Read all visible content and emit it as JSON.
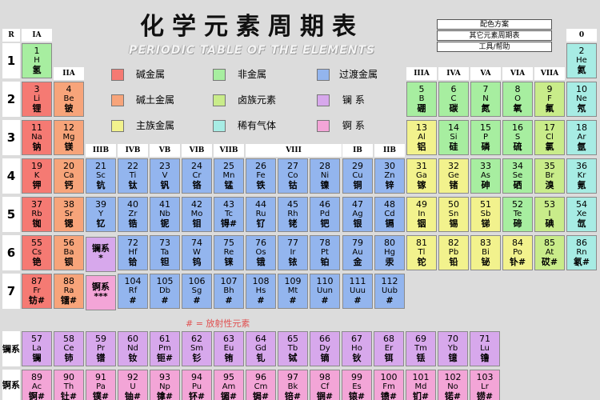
{
  "title": "化学元素周期表",
  "subtitle": "PERIODIC TABLE OF THE ELEMENTS",
  "menu": [
    "配色方案",
    "其它元素周期表",
    "工具/帮助"
  ],
  "r_label": "R",
  "group_headers": {
    "ia": "IA",
    "iia": "IIA",
    "iiia": "IIIA",
    "iva": "IVA",
    "va": "VA",
    "via": "VIA",
    "viia": "VIIA",
    "zero": "0",
    "iiib": "IIIB",
    "ivb": "IVB",
    "vb": "VB",
    "vib": "VIB",
    "viib": "VIIB",
    "viii": "VIII",
    "ib": "IB",
    "iib": "IIB"
  },
  "periods": [
    "1",
    "2",
    "3",
    "4",
    "5",
    "6",
    "7"
  ],
  "legend": [
    {
      "label": "碱金属",
      "color": "#f57a73"
    },
    {
      "label": "非金属",
      "color": "#a7eea0"
    },
    {
      "label": "过渡金属",
      "color": "#93b5ee"
    },
    {
      "label": "碱土金属",
      "color": "#f7a47a"
    },
    {
      "label": "卤族元素",
      "color": "#c9ec8a"
    },
    {
      "label": "镧 系",
      "color": "#d7a8ec"
    },
    {
      "label": "主族金属",
      "color": "#f2f28d"
    },
    {
      "label": "稀有气体",
      "color": "#a7ece4"
    },
    {
      "label": "锕 系",
      "color": "#f3a5d7"
    }
  ],
  "radio_note": "# = 放射性元素",
  "series_labels": {
    "la": "镧系",
    "ac": "锕系"
  },
  "la_placeholder": {
    "text1": "镧系",
    "text2": "*"
  },
  "ac_placeholder": {
    "text1": "锕系",
    "text2": "***"
  },
  "elements": [
    {
      "n": "1",
      "s": "H",
      "c": "氢",
      "cat": "nm",
      "r": 0,
      "g": 1
    },
    {
      "n": "2",
      "s": "He",
      "c": "氦",
      "cat": "ng",
      "r": 0,
      "g": 18
    },
    {
      "n": "3",
      "s": "Li",
      "c": "锂",
      "cat": "alk",
      "r": 1,
      "g": 1
    },
    {
      "n": "4",
      "s": "Be",
      "c": "铍",
      "cat": "ae",
      "r": 1,
      "g": 2
    },
    {
      "n": "5",
      "s": "B",
      "c": "硼",
      "cat": "nm",
      "r": 1,
      "g": 13
    },
    {
      "n": "6",
      "s": "C",
      "c": "碳",
      "cat": "nm",
      "r": 1,
      "g": 14
    },
    {
      "n": "7",
      "s": "N",
      "c": "氮",
      "cat": "nm",
      "r": 1,
      "g": 15
    },
    {
      "n": "8",
      "s": "O",
      "c": "氧",
      "cat": "nm",
      "r": 1,
      "g": 16
    },
    {
      "n": "9",
      "s": "F",
      "c": "氟",
      "cat": "hal",
      "r": 1,
      "g": 17
    },
    {
      "n": "10",
      "s": "Ne",
      "c": "氖",
      "cat": "ng",
      "r": 1,
      "g": 18
    },
    {
      "n": "11",
      "s": "Na",
      "c": "钠",
      "cat": "alk",
      "r": 2,
      "g": 1
    },
    {
      "n": "12",
      "s": "Mg",
      "c": "镁",
      "cat": "ae",
      "r": 2,
      "g": 2
    },
    {
      "n": "13",
      "s": "Al",
      "c": "铝",
      "cat": "pm",
      "r": 2,
      "g": 13
    },
    {
      "n": "14",
      "s": "Si",
      "c": "硅",
      "cat": "nm",
      "r": 2,
      "g": 14
    },
    {
      "n": "15",
      "s": "P",
      "c": "磷",
      "cat": "nm",
      "r": 2,
      "g": 15
    },
    {
      "n": "16",
      "s": "S",
      "c": "硫",
      "cat": "nm",
      "r": 2,
      "g": 16
    },
    {
      "n": "17",
      "s": "Cl",
      "c": "氯",
      "cat": "hal",
      "r": 2,
      "g": 17
    },
    {
      "n": "18",
      "s": "Ar",
      "c": "氩",
      "cat": "ng",
      "r": 2,
      "g": 18
    },
    {
      "n": "19",
      "s": "K",
      "c": "钾",
      "cat": "alk",
      "r": 3,
      "g": 1
    },
    {
      "n": "20",
      "s": "Ca",
      "c": "钙",
      "cat": "ae",
      "r": 3,
      "g": 2
    },
    {
      "n": "21",
      "s": "Sc",
      "c": "钪",
      "cat": "tm",
      "r": 3,
      "g": 3
    },
    {
      "n": "22",
      "s": "Ti",
      "c": "钛",
      "cat": "tm",
      "r": 3,
      "g": 4
    },
    {
      "n": "23",
      "s": "V",
      "c": "钒",
      "cat": "tm",
      "r": 3,
      "g": 5
    },
    {
      "n": "24",
      "s": "Cr",
      "c": "铬",
      "cat": "tm",
      "r": 3,
      "g": 6
    },
    {
      "n": "25",
      "s": "Mn",
      "c": "锰",
      "cat": "tm",
      "r": 3,
      "g": 7
    },
    {
      "n": "26",
      "s": "Fe",
      "c": "铁",
      "cat": "tm",
      "r": 3,
      "g": 8
    },
    {
      "n": "27",
      "s": "Co",
      "c": "钴",
      "cat": "tm",
      "r": 3,
      "g": 9
    },
    {
      "n": "28",
      "s": "Ni",
      "c": "镍",
      "cat": "tm",
      "r": 3,
      "g": 10
    },
    {
      "n": "29",
      "s": "Cu",
      "c": "铜",
      "cat": "tm",
      "r": 3,
      "g": 11
    },
    {
      "n": "30",
      "s": "Zn",
      "c": "锌",
      "cat": "tm",
      "r": 3,
      "g": 12
    },
    {
      "n": "31",
      "s": "Ga",
      "c": "镓",
      "cat": "pm",
      "r": 3,
      "g": 13
    },
    {
      "n": "32",
      "s": "Ge",
      "c": "锗",
      "cat": "pm",
      "r": 3,
      "g": 14
    },
    {
      "n": "33",
      "s": "As",
      "c": "砷",
      "cat": "nm",
      "r": 3,
      "g": 15
    },
    {
      "n": "34",
      "s": "Se",
      "c": "硒",
      "cat": "nm",
      "r": 3,
      "g": 16
    },
    {
      "n": "35",
      "s": "Br",
      "c": "溴",
      "cat": "hal",
      "r": 3,
      "g": 17
    },
    {
      "n": "36",
      "s": "Kr",
      "c": "氪",
      "cat": "ng",
      "r": 3,
      "g": 18
    },
    {
      "n": "37",
      "s": "Rb",
      "c": "铷",
      "cat": "alk",
      "r": 4,
      "g": 1
    },
    {
      "n": "38",
      "s": "Sr",
      "c": "锶",
      "cat": "ae",
      "r": 4,
      "g": 2
    },
    {
      "n": "39",
      "s": "Y",
      "c": "钇",
      "cat": "tm",
      "r": 4,
      "g": 3
    },
    {
      "n": "40",
      "s": "Zr",
      "c": "锆",
      "cat": "tm",
      "r": 4,
      "g": 4
    },
    {
      "n": "41",
      "s": "Nb",
      "c": "铌",
      "cat": "tm",
      "r": 4,
      "g": 5
    },
    {
      "n": "42",
      "s": "Mo",
      "c": "钼",
      "cat": "tm",
      "r": 4,
      "g": 6
    },
    {
      "n": "43",
      "s": "Tc",
      "c": "锝#",
      "cat": "tm",
      "r": 4,
      "g": 7
    },
    {
      "n": "44",
      "s": "Ru",
      "c": "钌",
      "cat": "tm",
      "r": 4,
      "g": 8
    },
    {
      "n": "45",
      "s": "Rh",
      "c": "铑",
      "cat": "tm",
      "r": 4,
      "g": 9
    },
    {
      "n": "46",
      "s": "Pd",
      "c": "钯",
      "cat": "tm",
      "r": 4,
      "g": 10
    },
    {
      "n": "47",
      "s": "Ag",
      "c": "银",
      "cat": "tm",
      "r": 4,
      "g": 11
    },
    {
      "n": "48",
      "s": "Cd",
      "c": "镉",
      "cat": "tm",
      "r": 4,
      "g": 12
    },
    {
      "n": "49",
      "s": "In",
      "c": "铟",
      "cat": "pm",
      "r": 4,
      "g": 13
    },
    {
      "n": "50",
      "s": "Sn",
      "c": "锡",
      "cat": "pm",
      "r": 4,
      "g": 14
    },
    {
      "n": "51",
      "s": "Sb",
      "c": "锑",
      "cat": "pm",
      "r": 4,
      "g": 15
    },
    {
      "n": "52",
      "s": "Te",
      "c": "碲",
      "cat": "nm",
      "r": 4,
      "g": 16
    },
    {
      "n": "53",
      "s": "I",
      "c": "碘",
      "cat": "hal",
      "r": 4,
      "g": 17
    },
    {
      "n": "54",
      "s": "Xe",
      "c": "氙",
      "cat": "ng",
      "r": 4,
      "g": 18
    },
    {
      "n": "55",
      "s": "Cs",
      "c": "铯",
      "cat": "alk",
      "r": 5,
      "g": 1
    },
    {
      "n": "56",
      "s": "Ba",
      "c": "钡",
      "cat": "ae",
      "r": 5,
      "g": 2
    },
    {
      "n": "72",
      "s": "Hf",
      "c": "铪",
      "cat": "tm",
      "r": 5,
      "g": 4
    },
    {
      "n": "73",
      "s": "Ta",
      "c": "钽",
      "cat": "tm",
      "r": 5,
      "g": 5
    },
    {
      "n": "74",
      "s": "W",
      "c": "钨",
      "cat": "tm",
      "r": 5,
      "g": 6
    },
    {
      "n": "75",
      "s": "Re",
      "c": "铼",
      "cat": "tm",
      "r": 5,
      "g": 7
    },
    {
      "n": "76",
      "s": "Os",
      "c": "锇",
      "cat": "tm",
      "r": 5,
      "g": 8
    },
    {
      "n": "77",
      "s": "Ir",
      "c": "铱",
      "cat": "tm",
      "r": 5,
      "g": 9
    },
    {
      "n": "78",
      "s": "Pt",
      "c": "铂",
      "cat": "tm",
      "r": 5,
      "g": 10
    },
    {
      "n": "79",
      "s": "Au",
      "c": "金",
      "cat": "tm",
      "r": 5,
      "g": 11
    },
    {
      "n": "80",
      "s": "Hg",
      "c": "汞",
      "cat": "tm",
      "r": 5,
      "g": 12
    },
    {
      "n": "81",
      "s": "Tl",
      "c": "铊",
      "cat": "pm",
      "r": 5,
      "g": 13
    },
    {
      "n": "82",
      "s": "Pb",
      "c": "铅",
      "cat": "pm",
      "r": 5,
      "g": 14
    },
    {
      "n": "83",
      "s": "Bi",
      "c": "铋",
      "cat": "pm",
      "r": 5,
      "g": 15
    },
    {
      "n": "84",
      "s": "Po",
      "c": "钋#",
      "cat": "pm",
      "r": 5,
      "g": 16
    },
    {
      "n": "85",
      "s": "At",
      "c": "砹#",
      "cat": "hal",
      "r": 5,
      "g": 17
    },
    {
      "n": "86",
      "s": "Rn",
      "c": "氡#",
      "cat": "ng",
      "r": 5,
      "g": 18
    },
    {
      "n": "87",
      "s": "Fr",
      "c": "钫#",
      "cat": "alk",
      "r": 6,
      "g": 1
    },
    {
      "n": "88",
      "s": "Ra",
      "c": "镭#",
      "cat": "ae",
      "r": 6,
      "g": 2
    },
    {
      "n": "104",
      "s": "Rf",
      "c": "#",
      "cat": "tm",
      "r": 6,
      "g": 4
    },
    {
      "n": "105",
      "s": "Db",
      "c": "#",
      "cat": "tm",
      "r": 6,
      "g": 5
    },
    {
      "n": "106",
      "s": "Sg",
      "c": "#",
      "cat": "tm",
      "r": 6,
      "g": 6
    },
    {
      "n": "107",
      "s": "Bh",
      "c": "#",
      "cat": "tm",
      "r": 6,
      "g": 7
    },
    {
      "n": "108",
      "s": "Hs",
      "c": "#",
      "cat": "tm",
      "r": 6,
      "g": 8
    },
    {
      "n": "109",
      "s": "Mt",
      "c": "#",
      "cat": "tm",
      "r": 6,
      "g": 9
    },
    {
      "n": "110",
      "s": "Uun",
      "c": "#",
      "cat": "tm",
      "r": 6,
      "g": 10
    },
    {
      "n": "111",
      "s": "Uuu",
      "c": "#",
      "cat": "tm",
      "r": 6,
      "g": 11
    },
    {
      "n": "112",
      "s": "Uub",
      "c": "#",
      "cat": "tm",
      "r": 6,
      "g": 12
    }
  ],
  "lanthanides": [
    {
      "n": "57",
      "s": "La",
      "c": "镧"
    },
    {
      "n": "58",
      "s": "Ce",
      "c": "铈"
    },
    {
      "n": "59",
      "s": "Pr",
      "c": "镨"
    },
    {
      "n": "60",
      "s": "Nd",
      "c": "钕"
    },
    {
      "n": "61",
      "s": "Pm",
      "c": "钷#"
    },
    {
      "n": "62",
      "s": "Sm",
      "c": "钐"
    },
    {
      "n": "63",
      "s": "Eu",
      "c": "铕"
    },
    {
      "n": "64",
      "s": "Gd",
      "c": "钆"
    },
    {
      "n": "65",
      "s": "Tb",
      "c": "铽"
    },
    {
      "n": "66",
      "s": "Dy",
      "c": "镝"
    },
    {
      "n": "67",
      "s": "Ho",
      "c": "钬"
    },
    {
      "n": "68",
      "s": "Er",
      "c": "铒"
    },
    {
      "n": "69",
      "s": "Tm",
      "c": "铥"
    },
    {
      "n": "70",
      "s": "Yb",
      "c": "镱"
    },
    {
      "n": "71",
      "s": "Lu",
      "c": "镥"
    }
  ],
  "actinides": [
    {
      "n": "89",
      "s": "Ac",
      "c": "锕#"
    },
    {
      "n": "90",
      "s": "Th",
      "c": "钍#"
    },
    {
      "n": "91",
      "s": "Pa",
      "c": "镤#"
    },
    {
      "n": "92",
      "s": "U",
      "c": "铀#"
    },
    {
      "n": "93",
      "s": "Np",
      "c": "镎#"
    },
    {
      "n": "94",
      "s": "Pu",
      "c": "钚#"
    },
    {
      "n": "95",
      "s": "Am",
      "c": "镅#"
    },
    {
      "n": "96",
      "s": "Cm",
      "c": "锔#"
    },
    {
      "n": "97",
      "s": "Bk",
      "c": "锫#"
    },
    {
      "n": "98",
      "s": "Cf",
      "c": "锎#"
    },
    {
      "n": "99",
      "s": "Es",
      "c": "锿#"
    },
    {
      "n": "100",
      "s": "Fm",
      "c": "镄#"
    },
    {
      "n": "101",
      "s": "Md",
      "c": "钔#"
    },
    {
      "n": "102",
      "s": "No",
      "c": "锘#"
    },
    {
      "n": "103",
      "s": "Lr",
      "c": "铹#"
    }
  ]
}
